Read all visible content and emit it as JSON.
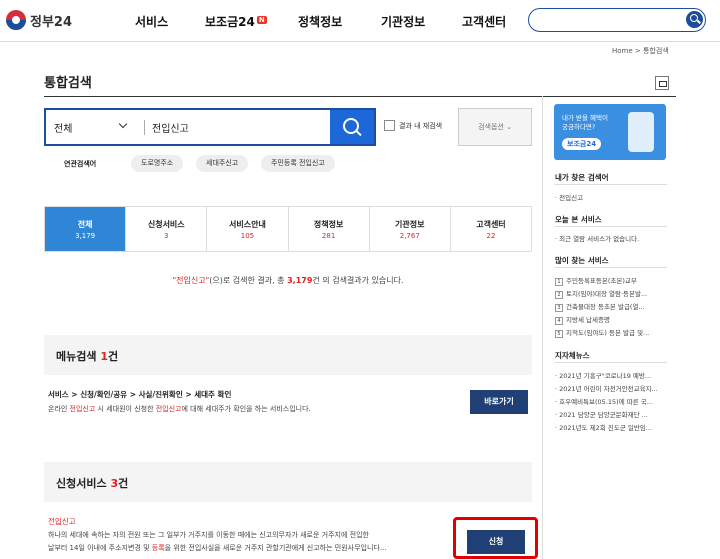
{
  "header": {
    "logo_text": "정부24",
    "nav": [
      "서비스",
      "보조금24",
      "정책정보",
      "기관정보",
      "고객센터"
    ],
    "nav_badge": "N"
  },
  "breadcrumb": "Home > 통합검색",
  "page_title": "통합검색",
  "search": {
    "scope": "전체",
    "query": "전입신고",
    "recheck_label": "결과 내 재검색",
    "options_label": "검색옵션"
  },
  "related": {
    "label": "연관검색어",
    "tags": [
      "도로명주소",
      "세대주신고",
      "주민등록 전입신고"
    ]
  },
  "tabs": [
    {
      "label": "전체",
      "count": "3,179"
    },
    {
      "label": "신청서비스",
      "count": "3"
    },
    {
      "label": "서비스안내",
      "count": "105"
    },
    {
      "label": "정책정보",
      "count": "281"
    },
    {
      "label": "기관정보",
      "count": "2,767"
    },
    {
      "label": "고객센터",
      "count": "22"
    }
  ],
  "result_message": {
    "keyword": "\"전입신고\"",
    "part1": "(으)로 검색한 결과, 총 ",
    "total": "3,179",
    "part2": "건 의 검색결과가 있습니다."
  },
  "menu_section": {
    "title": "메뉴검색",
    "count": "1",
    "suffix": "건",
    "path": "서비스 > 신청/확인/공유 > 사실/진위확인 > 세대주 확인",
    "desc_pre": "온라인 ",
    "desc_hl1": "전입신고",
    "desc_mid": " 시 세대원이 신청한 ",
    "desc_hl2": "전입신고",
    "desc_post": "에 대해 세대주가 확인을 하는 서비스입니다.",
    "button": "바로가기"
  },
  "apply_section": {
    "title": "신청서비스",
    "count": "3",
    "suffix": "건",
    "item_title": "전입신고",
    "body_1": "하나의 세대에 속하는 자의 전원 또는 그 일부가 거주지를 이동한 때에는 신고의무자가 새로운 거주지에 전입한",
    "body_2a": "날부터 14일 이내에 주소지변경 및 ",
    "body_2hl": "등록",
    "body_2b": "을 위한 전입사실을 새로운 거주지 관할기관에게 신고하는 민원사무입니다...",
    "button": "신청"
  },
  "sidebar": {
    "banner_line1": "내가 받을 혜택이",
    "banner_line2": "궁금하다면?",
    "banner_pill": "보조금24",
    "my_search_title": "내가 찾은 검색어",
    "my_search_items": [
      "· 전입신고"
    ],
    "today_title": "오늘 본 서비스",
    "today_items": [
      "· 최근 열람 서비스가 없습니다."
    ],
    "popular_title": "많이 찾는 서비스",
    "popular_items": [
      "주민등록표등본(초본)교부",
      "토지(임야)대장 열람·등본발...",
      "건축물대장 등초본 발급(열...",
      "지방세 납세증명",
      "지적도(임야도) 등본 발급 및..."
    ],
    "news_title": "지자체뉴스",
    "news_items": [
      "· 2021년 기흥구\"코로나19 예방...",
      "· 2021년 어린이 자전거안전교육지...",
      "· 호우예비특보(05.15)에 따른 국...",
      "· 2021 담양군 담양군문화재단 ...",
      "· 2021년도 제2회 진도군 일반임..."
    ]
  }
}
